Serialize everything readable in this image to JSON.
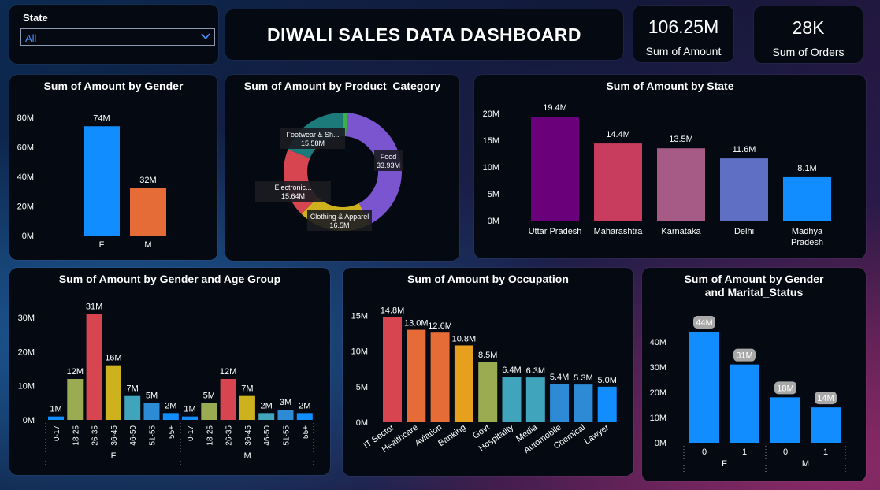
{
  "slicer": {
    "label": "State",
    "value": "All"
  },
  "header": {
    "title": "DIWALI SALES DATA DASHBOARD"
  },
  "kpis": [
    {
      "value": "106.25M",
      "label": "Sum of Amount"
    },
    {
      "value": "28K",
      "label": "Sum of Orders"
    }
  ],
  "colors": {
    "blue": "#118dff",
    "orange": "#e66c37",
    "red": "#d64550",
    "olive": "#9bab51",
    "yellow": "#cdb11d",
    "teal": "#41a4bd",
    "purple": "#6b007b",
    "magenta": "#c83d5e",
    "rose": "#a65b87",
    "lavender": "#5f6fc4",
    "chart_blue": "#2489ea",
    "bg": "#050a12"
  },
  "chart_data": [
    {
      "id": "gender",
      "type": "bar",
      "title": "Sum of Amount by Gender",
      "categories": [
        "F",
        "M"
      ],
      "values": [
        74,
        32
      ],
      "data_labels": [
        "74M",
        "32M"
      ],
      "bar_colors": [
        "#118dff",
        "#e66c37"
      ],
      "y_ticks": [
        "0M",
        "20M",
        "40M",
        "60M",
        "80M"
      ],
      "ylim": [
        0,
        80
      ],
      "unit": "M"
    },
    {
      "id": "category",
      "type": "pie",
      "title": "Sum of Amount by Product_Category",
      "style": "donut",
      "slices": [
        {
          "label": "Food",
          "value": 33.93,
          "value_label": "33.93M",
          "color": "#7b55d0"
        },
        {
          "label": "Clothing & Apparel",
          "value": 16.5,
          "value_label": "16.5M",
          "color": "#cdb11d"
        },
        {
          "label": "Electronic...",
          "value": 15.64,
          "value_label": "15.64M",
          "color": "#d64550"
        },
        {
          "label": "Footwear & Sh...",
          "value": 15.58,
          "value_label": "15.58M",
          "color": "#1d7a7a"
        },
        {
          "label": "",
          "value": 1.2,
          "value_label": "",
          "color": "#3cb04a"
        }
      ]
    },
    {
      "id": "state",
      "type": "bar",
      "title": "Sum of Amount by State",
      "categories": [
        "Uttar Pradesh",
        "Maharashtra",
        "Karnataka",
        "Delhi",
        "Madhya Pradesh"
      ],
      "values": [
        19.4,
        14.4,
        13.5,
        11.6,
        8.1
      ],
      "data_labels": [
        "19.4M",
        "14.4M",
        "13.5M",
        "11.6M",
        "8.1M"
      ],
      "bar_colors": [
        "#6b007b",
        "#c83d5e",
        "#a65b87",
        "#5f6fc4",
        "#118dff"
      ],
      "y_ticks": [
        "0M",
        "5M",
        "10M",
        "15M",
        "20M"
      ],
      "ylim": [
        0,
        20
      ],
      "unit": "M"
    },
    {
      "id": "agegroup",
      "type": "bar",
      "title": "Sum of Amount by Gender and Age Group",
      "groups": [
        {
          "name": "F",
          "categories": [
            "0-17",
            "18-25",
            "26-35",
            "36-45",
            "46-50",
            "51-55",
            "55+"
          ],
          "values": [
            1,
            12,
            31,
            16,
            7,
            5,
            2
          ],
          "data_labels": [
            "1M",
            "12M",
            "31M",
            "16M",
            "7M",
            "5M",
            "2M"
          ]
        },
        {
          "name": "M",
          "categories": [
            "0-17",
            "18-25",
            "26-35",
            "36-45",
            "46-50",
            "51-55",
            "55+"
          ],
          "values": [
            1,
            5,
            12,
            7,
            2,
            3,
            2
          ],
          "data_labels": [
            "1M",
            "5M",
            "12M",
            "7M",
            "2M",
            "3M",
            "2M"
          ]
        }
      ],
      "category_colors": [
        "#118dff",
        "#9bab51",
        "#d64550",
        "#cdb11d",
        "#41a4bd",
        "#2d8bd6",
        "#118dff"
      ],
      "y_ticks": [
        "0M",
        "10M",
        "20M",
        "30M"
      ],
      "ylim": [
        0,
        33
      ],
      "unit": "M"
    },
    {
      "id": "occupation",
      "type": "bar",
      "title": "Sum of Amount by Occupation",
      "categories": [
        "IT Sector",
        "Healthcare",
        "Aviation",
        "Banking",
        "Govt",
        "Hospitality",
        "Media",
        "Automobile",
        "Chemical",
        "Lawyer"
      ],
      "values": [
        14.8,
        13.0,
        12.6,
        10.8,
        8.5,
        6.4,
        6.3,
        5.4,
        5.3,
        5.0
      ],
      "data_labels": [
        "14.8M",
        "13.0M",
        "12.6M",
        "10.8M",
        "8.5M",
        "6.4M",
        "6.3M",
        "5.4M",
        "5.3M",
        "5.0M"
      ],
      "bar_colors": [
        "#d64550",
        "#e66c37",
        "#e66c37",
        "#e6a01d",
        "#9bab51",
        "#41a4bd",
        "#41a4bd",
        "#2d8bd6",
        "#2d8bd6",
        "#118dff"
      ],
      "y_ticks": [
        "0M",
        "5M",
        "10M",
        "15M"
      ],
      "ylim": [
        0,
        15.5
      ],
      "unit": "M"
    },
    {
      "id": "marital",
      "type": "bar",
      "title": "Sum of Amount by Gender and Marital_Status",
      "groups": [
        {
          "name": "F",
          "categories": [
            "0",
            "1"
          ],
          "values": [
            44,
            31
          ],
          "data_labels": [
            "44M",
            "31M"
          ]
        },
        {
          "name": "M",
          "categories": [
            "0",
            "1"
          ],
          "values": [
            18,
            14
          ],
          "data_labels": [
            "18M",
            "14M"
          ]
        }
      ],
      "bar_color": "#118dff",
      "y_ticks": [
        "0M",
        "10M",
        "20M",
        "30M",
        "40M"
      ],
      "ylim": [
        0,
        44
      ],
      "unit": "M"
    }
  ]
}
